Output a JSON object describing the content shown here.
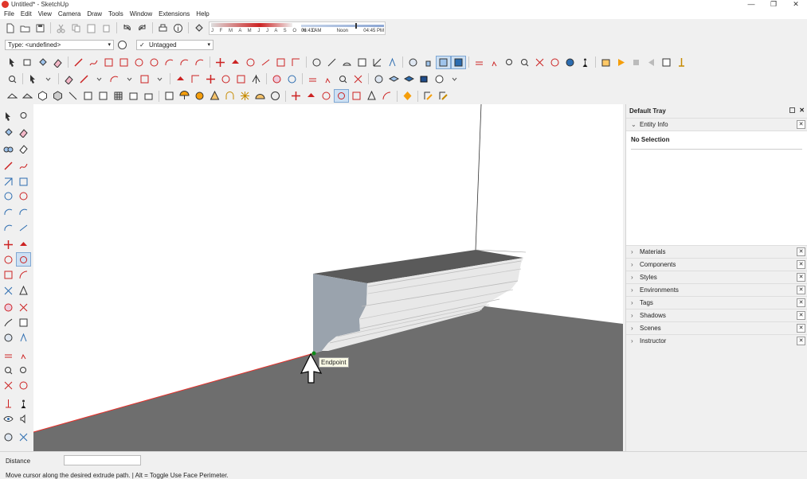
{
  "window": {
    "title": "Untitled* - SketchUp",
    "minimize": "—",
    "restore": "❐",
    "close": "✕"
  },
  "menu": [
    "File",
    "Edit",
    "View",
    "Camera",
    "Draw",
    "Tools",
    "Window",
    "Extensions",
    "Help"
  ],
  "shadow": {
    "months": "J F M A M J J A S O N D",
    "time_start": "06:43 AM",
    "time_mid": "Noon",
    "time_end": "04:45 PM"
  },
  "type_dropdown": {
    "value": "Type: <undefined>"
  },
  "tag_dropdown": {
    "value": "Untagged",
    "checked": "✓"
  },
  "viewport": {
    "inference_tooltip": "Endpoint",
    "background": "#ffffff",
    "ground": "#6e6e6e",
    "inference_color": "#e8302a"
  },
  "tray": {
    "title": "Default Tray",
    "entity_info": {
      "label": "Entity Info",
      "selection": "No Selection"
    },
    "panels": [
      "Materials",
      "Components",
      "Styles",
      "Environments",
      "Tags",
      "Shadows",
      "Scenes",
      "Instructor"
    ]
  },
  "status": {
    "vcb_label": "Distance",
    "vcb_value": "",
    "hint": "Move cursor along the desired extrude path. | Alt = Toggle Use Face Perimeter."
  }
}
